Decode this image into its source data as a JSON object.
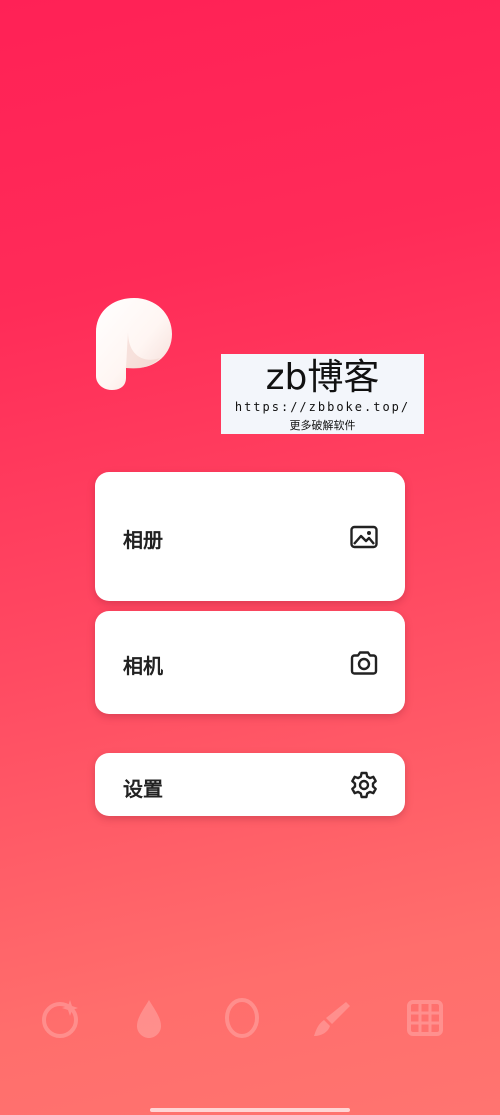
{
  "watermark": {
    "title": "zb博客",
    "url": "https://zbboke.top/",
    "subtitle": "更多破解软件"
  },
  "menu": {
    "album_label": "相册",
    "camera_label": "相机",
    "settings_label": "设置"
  },
  "icons": {
    "logo": "p-logo-icon",
    "album": "image-icon",
    "camera": "camera-icon",
    "settings": "gear-icon"
  },
  "colors": {
    "gradient_top": "#ff2156",
    "gradient_bottom": "#ff7470",
    "card": "#ffffff",
    "text": "#222222"
  }
}
